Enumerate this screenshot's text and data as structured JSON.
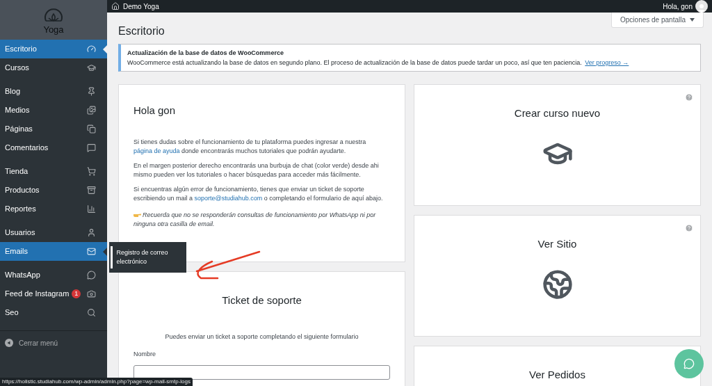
{
  "topbar": {
    "site": "Demo Yoga",
    "greeting": "Hola, gon"
  },
  "sidebar": {
    "logo": "Yoga",
    "groups": [
      [
        {
          "label": "Escritorio",
          "selected": true
        },
        {
          "label": "Cursos",
          "selected": false
        }
      ],
      [
        {
          "label": "Blog",
          "selected": false
        },
        {
          "label": "Medios",
          "selected": false
        },
        {
          "label": "Páginas",
          "selected": false
        },
        {
          "label": "Comentarios",
          "selected": false
        }
      ],
      [
        {
          "label": "Tienda",
          "selected": false
        },
        {
          "label": "Productos",
          "selected": false
        },
        {
          "label": "Reportes",
          "selected": false
        }
      ],
      [
        {
          "label": "Usuarios",
          "selected": false
        },
        {
          "label": "Emails",
          "selected": true
        }
      ],
      [
        {
          "label": "WhatsApp",
          "selected": false
        },
        {
          "label": "Feed de Instagram",
          "selected": false,
          "badge": "1"
        },
        {
          "label": "Seo",
          "selected": false
        }
      ]
    ],
    "collapse": "Cerrar menú",
    "flyout": "Registro de correo electrónico"
  },
  "page": {
    "title": "Escritorio",
    "screen_options": "Opciones de pantalla",
    "notice": {
      "title": "Actualización de la base de datos de WooCommerce",
      "text": "WooCommerce está actualizando la base de datos en segundo plano. El proceso de actualización de la base de datos puede tardar un poco, así que ten paciencia.",
      "link": "Ver progreso →"
    },
    "welcome": {
      "title": "Hola gon",
      "p1_before": "Si tienes dudas sobre el funcionamiento de tu plataforma puedes ingresar a nuestra",
      "p1_link": "página de ayuda",
      "p1_after": "donde encontrarás muchos tutoriales que podrán ayudarte.",
      "p2": "En el margen posterior derecho encontrarás una burbuja de chat (color verde) desde ahi mismo pueden ver los tutoriales o hacer búsquedas para acceder más fácilmente.",
      "p3_before": "Si encuentras algún error de funcionamiento, tienes que enviar un ticket de soporte escribiendo un mail a",
      "p3_link": "soporte@studiahub.com",
      "p3_after": "o completando el formulario de aquí abajo.",
      "note": "Recuerda que no se responderán consultas de funcionamiento por WhatsApp ni por ninguna otra casilla de email."
    },
    "ticket": {
      "title": "Ticket de soporte",
      "intro": "Puedes enviar un ticket a soporte completando el siguiente formulario",
      "field_label": "Nombre"
    },
    "shortcuts": [
      {
        "title": "Crear curso nuevo",
        "help": true
      },
      {
        "title": "Ver Sitio",
        "help": true
      },
      {
        "title": "Ver Pedidos"
      }
    ]
  },
  "status_url": "https://holistic.studiahub.com/wp-admin/admin.php?page=wp-mail-smtp-logs"
}
